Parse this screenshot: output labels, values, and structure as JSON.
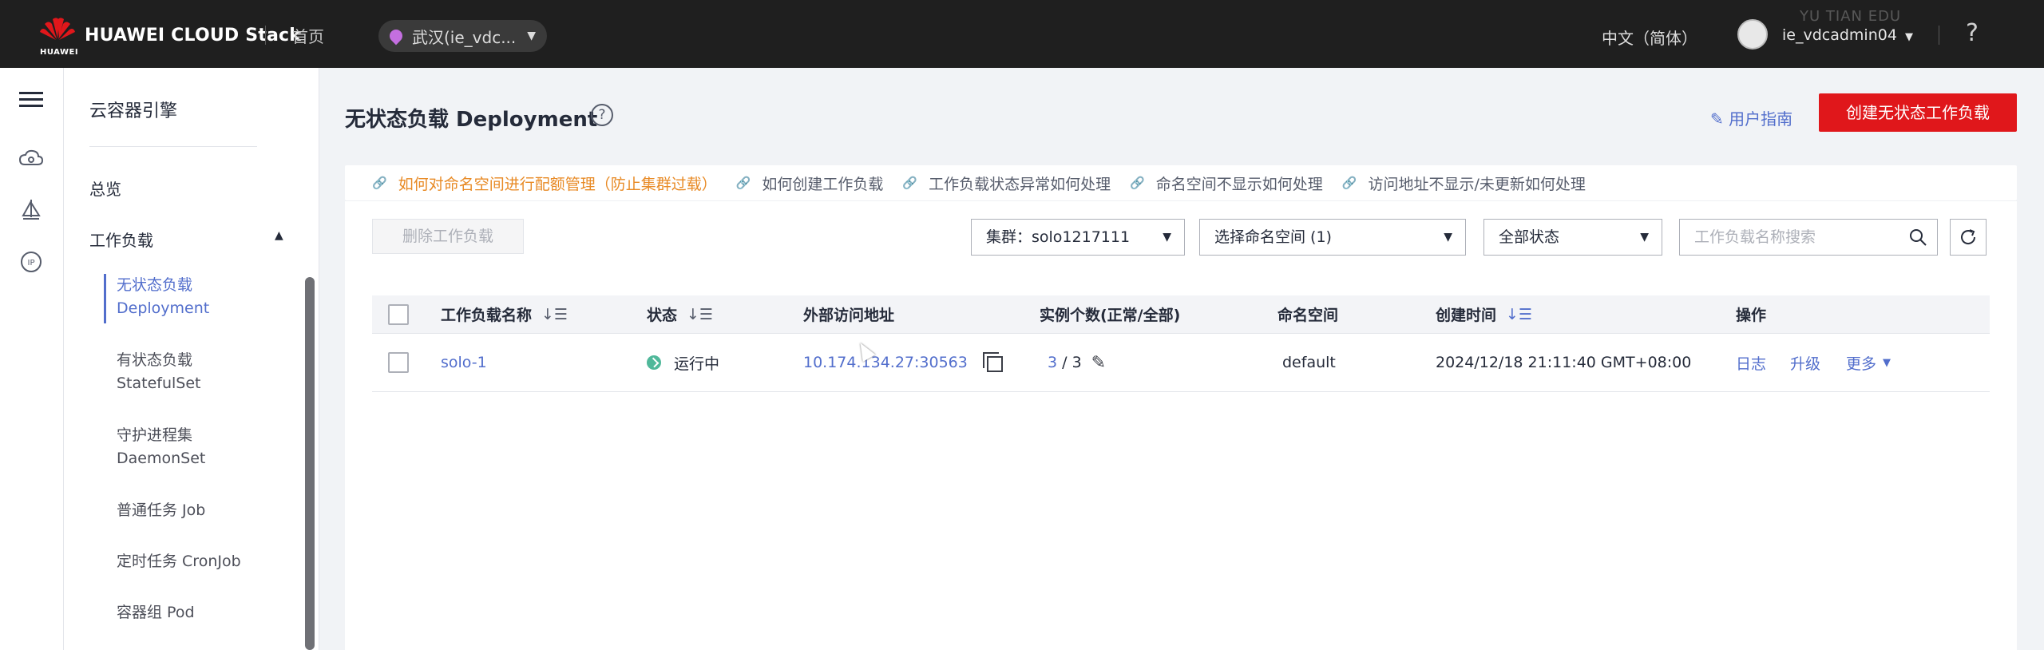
{
  "header": {
    "brand": "HUAWEI CLOUD Stack",
    "brand_sub": "HUAWEI",
    "home": "首页",
    "region": "武汉(ie_vdc...",
    "language": "中文（简体）",
    "username": "ie_vdcadmin04",
    "help_icon": "?",
    "watermark": "YU TIAN EDU"
  },
  "rail": {
    "icons": [
      "menu-icon",
      "cloud-icon",
      "sail-icon",
      "ip-icon"
    ],
    "ip_label": "IP"
  },
  "sidebar": {
    "title": "云容器引擎",
    "overview": "总览",
    "workloads": "工作负载",
    "items": [
      {
        "cn": "无状态负载",
        "en": "Deployment"
      },
      {
        "cn": "有状态负载",
        "en": "StatefulSet"
      },
      {
        "cn": "守护进程集",
        "en": "DaemonSet"
      },
      {
        "label": "普通任务 Job"
      },
      {
        "label": "定时任务 CronJob"
      },
      {
        "label": "容器组 Pod"
      }
    ]
  },
  "main": {
    "title": "无状态负载 Deployment",
    "title_help": "?",
    "guide": "用户指南",
    "create_button": "创建无状态工作负载",
    "tips": [
      "如何对命名空间进行配额管理（防止集群过载）",
      "如何创建工作负载",
      "工作负载状态异常如何处理",
      "命名空间不显示如何处理",
      "访问地址不显示/未更新如何处理"
    ],
    "toolbar": {
      "delete_button": "删除工作负载",
      "cluster_select": "集群：solo1217111",
      "namespace_select": "选择命名空间 (1)",
      "status_select": "全部状态",
      "search_placeholder": "工作负载名称搜索"
    },
    "table": {
      "columns": [
        "工作负载名称",
        "状态",
        "外部访问地址",
        "实例个数(正常/全部)",
        "命名空间",
        "创建时间",
        "操作"
      ],
      "rows": [
        {
          "name": "solo-1",
          "status": "运行中",
          "address": "10.174.134.27:30563",
          "instances_normal": "3",
          "instances_total": "/ 3",
          "namespace": "default",
          "created": "2024/12/18 21:11:40 GMT+08:00",
          "actions": [
            "日志",
            "升级",
            "更多"
          ]
        }
      ]
    }
  },
  "colors": {
    "accent": "#526ecc",
    "primary_red": "#e0171b",
    "topbar": "#1f1f1f",
    "running": "#50b89a",
    "warning_link": "#e88a25"
  }
}
